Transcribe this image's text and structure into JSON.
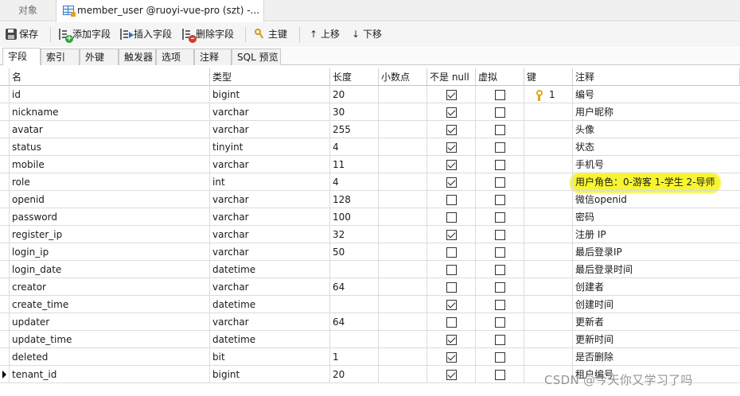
{
  "doc_tabs": [
    {
      "label": "对象"
    },
    {
      "label": "member_user @ruoyi-vue-pro (szt) -..."
    }
  ],
  "toolbar": {
    "save": "保存",
    "add_field": "添加字段",
    "insert_field": "插入字段",
    "delete_field": "删除字段",
    "primary_key": "主键",
    "move_up": "上移",
    "move_down": "下移"
  },
  "sub_tabs": [
    "字段",
    "索引",
    "外键",
    "触发器",
    "选项",
    "注释",
    "SQL 预览"
  ],
  "columns": {
    "name": "名",
    "type": "类型",
    "length": "长度",
    "decimals": "小数点",
    "not_null": "不是 null",
    "virtual": "虚拟",
    "key": "键",
    "comment": "注释"
  },
  "rows": [
    {
      "name": "id",
      "type": "bigint",
      "length": "20",
      "decimals": "",
      "not_null": true,
      "virtual": false,
      "key": "1",
      "comment": "编号"
    },
    {
      "name": "nickname",
      "type": "varchar",
      "length": "30",
      "decimals": "",
      "not_null": true,
      "virtual": false,
      "key": "",
      "comment": "用户昵称"
    },
    {
      "name": "avatar",
      "type": "varchar",
      "length": "255",
      "decimals": "",
      "not_null": true,
      "virtual": false,
      "key": "",
      "comment": "头像"
    },
    {
      "name": "status",
      "type": "tinyint",
      "length": "4",
      "decimals": "",
      "not_null": true,
      "virtual": false,
      "key": "",
      "comment": "状态"
    },
    {
      "name": "mobile",
      "type": "varchar",
      "length": "11",
      "decimals": "",
      "not_null": true,
      "virtual": false,
      "key": "",
      "comment": "手机号"
    },
    {
      "name": "role",
      "type": "int",
      "length": "4",
      "decimals": "",
      "not_null": true,
      "virtual": false,
      "key": "",
      "comment": "用户角色：0-游客 1-学生 2-导师"
    },
    {
      "name": "openid",
      "type": "varchar",
      "length": "128",
      "decimals": "",
      "not_null": false,
      "virtual": false,
      "key": "",
      "comment": "微信openid"
    },
    {
      "name": "password",
      "type": "varchar",
      "length": "100",
      "decimals": "",
      "not_null": false,
      "virtual": false,
      "key": "",
      "comment": "密码"
    },
    {
      "name": "register_ip",
      "type": "varchar",
      "length": "32",
      "decimals": "",
      "not_null": true,
      "virtual": false,
      "key": "",
      "comment": "注册 IP"
    },
    {
      "name": "login_ip",
      "type": "varchar",
      "length": "50",
      "decimals": "",
      "not_null": false,
      "virtual": false,
      "key": "",
      "comment": "最后登录IP"
    },
    {
      "name": "login_date",
      "type": "datetime",
      "length": "",
      "decimals": "",
      "not_null": false,
      "virtual": false,
      "key": "",
      "comment": "最后登录时间"
    },
    {
      "name": "creator",
      "type": "varchar",
      "length": "64",
      "decimals": "",
      "not_null": false,
      "virtual": false,
      "key": "",
      "comment": "创建者"
    },
    {
      "name": "create_time",
      "type": "datetime",
      "length": "",
      "decimals": "",
      "not_null": true,
      "virtual": false,
      "key": "",
      "comment": "创建时间"
    },
    {
      "name": "updater",
      "type": "varchar",
      "length": "64",
      "decimals": "",
      "not_null": false,
      "virtual": false,
      "key": "",
      "comment": "更新者"
    },
    {
      "name": "update_time",
      "type": "datetime",
      "length": "",
      "decimals": "",
      "not_null": true,
      "virtual": false,
      "key": "",
      "comment": "更新时间"
    },
    {
      "name": "deleted",
      "type": "bit",
      "length": "1",
      "decimals": "",
      "not_null": true,
      "virtual": false,
      "key": "",
      "comment": "是否删除"
    },
    {
      "name": "tenant_id",
      "type": "bigint",
      "length": "20",
      "decimals": "",
      "not_null": true,
      "virtual": false,
      "key": "",
      "comment": "租户编号",
      "current": true
    }
  ],
  "highlight_color": "#f7f431",
  "watermark": "CSDN @今天你又学习了吗"
}
